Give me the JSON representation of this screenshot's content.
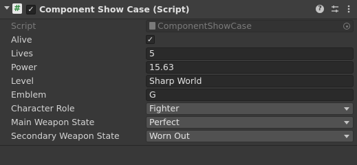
{
  "component": {
    "title": "Component Show Case (Script)",
    "script_icon_glyph": "#",
    "enabled_glyph": "✓"
  },
  "fields": {
    "script": {
      "label": "Script",
      "value": "ComponentShowCase"
    },
    "alive": {
      "label": "Alive",
      "checked": true,
      "glyph": "✓"
    },
    "lives": {
      "label": "Lives",
      "value": "5"
    },
    "power": {
      "label": "Power",
      "value": "15.63"
    },
    "level": {
      "label": "Level",
      "value": "Sharp World"
    },
    "emblem": {
      "label": "Emblem",
      "value": "G"
    },
    "character_role": {
      "label": "Character Role",
      "value": "Fighter"
    },
    "main_weapon_state": {
      "label": "Main Weapon State",
      "value": "Perfect"
    },
    "secondary_weapon_state": {
      "label": "Secondary Weapon State",
      "value": "Worn Out"
    }
  },
  "icons": {
    "help": "help-icon",
    "presets": "presets-icon",
    "menu": "kebab-menu-icon"
  },
  "colors": {
    "panel_bg": "#383838",
    "header_bg": "#3e3e3e",
    "field_bg": "#2a2a2a",
    "popup_bg": "#515151",
    "script_icon_green": "#2e8b3e"
  }
}
